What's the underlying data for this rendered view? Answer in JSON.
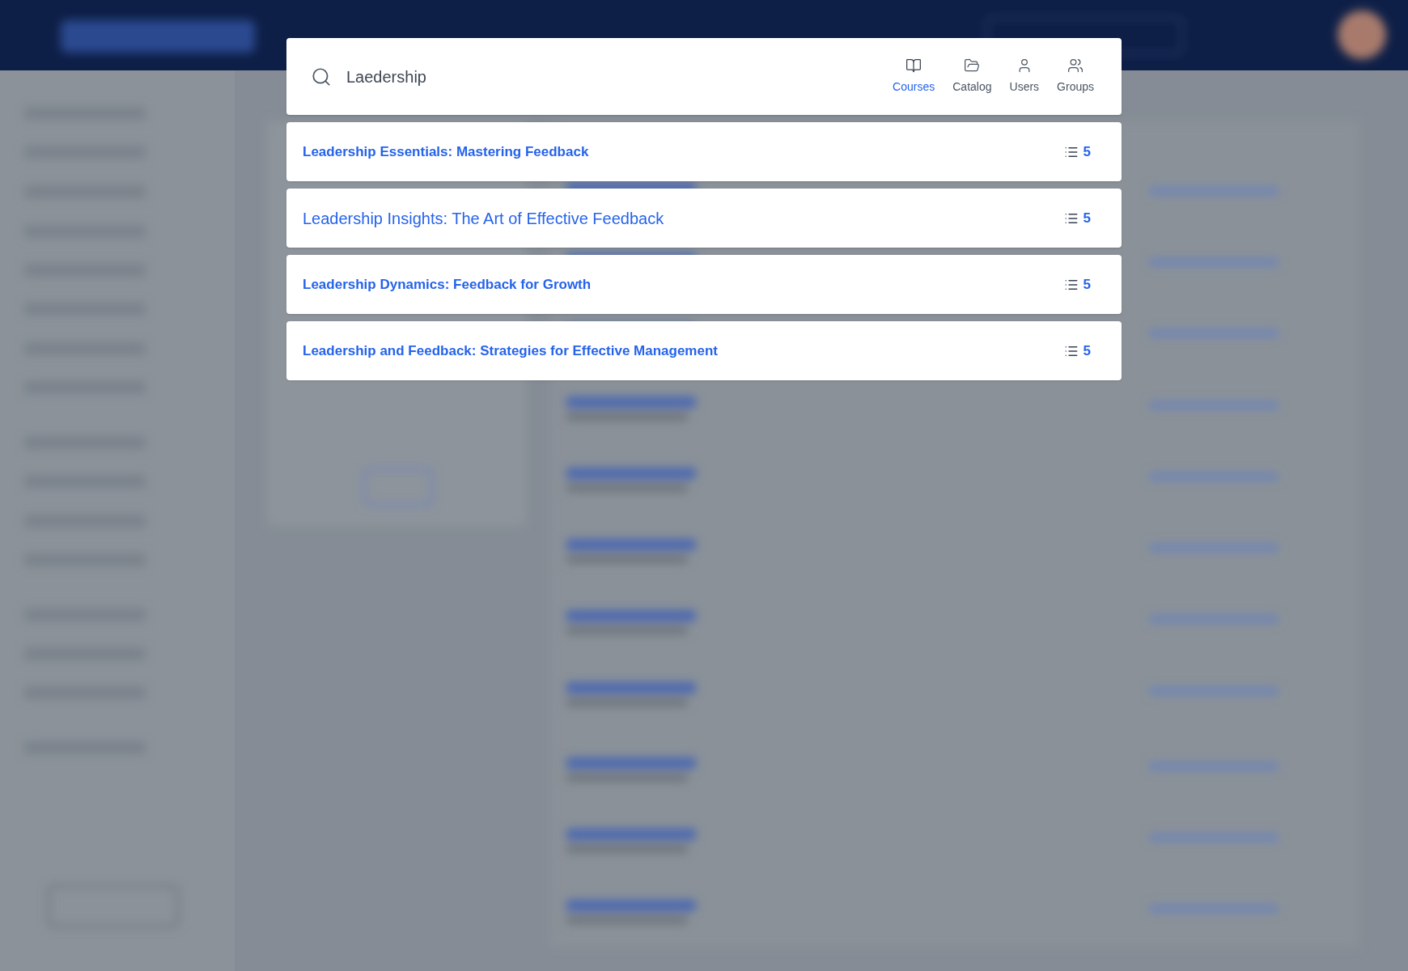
{
  "search": {
    "value": "Laedership"
  },
  "filters": [
    {
      "kind": "courses",
      "label": "Courses",
      "selected": true
    },
    {
      "kind": "catalog",
      "label": "Catalog",
      "selected": false
    },
    {
      "kind": "users",
      "label": "Users",
      "selected": false
    },
    {
      "kind": "groups",
      "label": "Groups",
      "selected": false
    }
  ],
  "results": [
    {
      "title": "Leadership Essentials: Mastering Feedback",
      "count": "5",
      "selected": false
    },
    {
      "title": "Leadership Insights: The Art of Effective Feedback",
      "count": "5",
      "selected": true
    },
    {
      "title": "Leadership Dynamics: Feedback for Growth",
      "count": "5",
      "selected": false
    },
    {
      "title": "Leadership and Feedback: Strategies for Effective Management",
      "count": "5",
      "selected": false
    }
  ]
}
